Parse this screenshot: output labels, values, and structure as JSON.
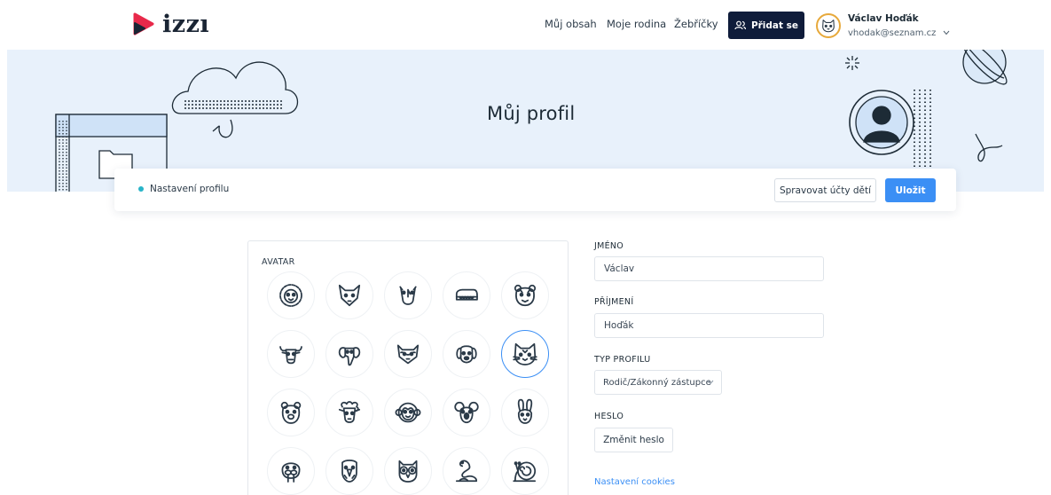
{
  "brand": {
    "name": "izzı"
  },
  "nav": {
    "links": [
      "Můj obsah",
      "Moje rodina",
      "Žebříčky"
    ],
    "add_button": "Přidat se",
    "user": {
      "name": "Václav Hoďák",
      "email": "vhodak@seznam.cz"
    }
  },
  "hero": {
    "title": "Můj profil"
  },
  "settings_bar": {
    "label": "Nastavení profilu",
    "manage_button": "Spravovat účty dětí",
    "save_button": "Uložit"
  },
  "avatar": {
    "label": "AVATAR",
    "items": [
      "lion-icon",
      "fox-icon",
      "rhino-icon",
      "crocodile-icon",
      "tiger-icon",
      "bull-icon",
      "elephant-icon",
      "raccoon-icon",
      "dog-icon",
      "cat-icon",
      "bear-icon",
      "sheep-icon",
      "monkey-icon",
      "koala-icon",
      "rabbit-icon",
      "walrus-icon",
      "eagle-icon",
      "owl-icon",
      "snake-icon",
      "snail-icon"
    ],
    "selected": "cat-icon"
  },
  "form": {
    "first_name": {
      "label": "JMÉNO",
      "value": "Václav"
    },
    "last_name": {
      "label": "PŘÍJMENÍ",
      "value": "Hoďák"
    },
    "profile_type": {
      "label": "TYP PROFILU",
      "value": "Rodič/Zákonný zástupce"
    },
    "password": {
      "label": "HESLO",
      "button": "Změnit heslo"
    },
    "cookies_link": "Nastavení cookies"
  },
  "colors": {
    "accent": "#3b8ff5",
    "navy": "#0f1c3a",
    "hero_bg": "#e8f1fb",
    "teal": "#28b4c8"
  }
}
